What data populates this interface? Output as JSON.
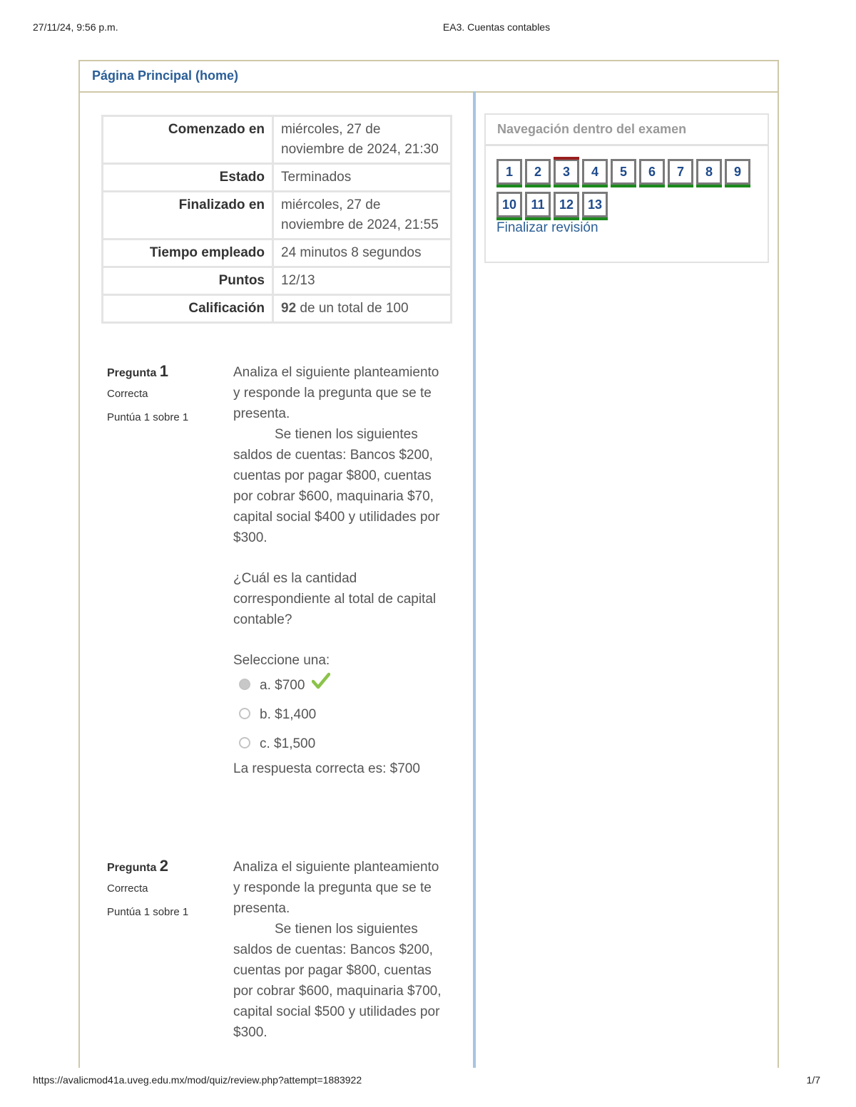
{
  "print": {
    "date": "27/11/24, 9:56 p.m.",
    "title": "EA3. Cuentas contables",
    "url": "https://avalicmod41a.uveg.edu.mx/mod/quiz/review.php?attempt=1883922",
    "page": "1/7"
  },
  "nav": {
    "home": "Página Principal (home)"
  },
  "summary": {
    "started_label": "Comenzado en",
    "started_value": "miércoles, 27 de noviembre de 2024, 21:30",
    "state_label": "Estado",
    "state_value": "Terminados",
    "finished_label": "Finalizado en",
    "finished_value": "miércoles, 27 de noviembre de 2024, 21:55",
    "time_label": "Tiempo empleado",
    "time_value": "24 minutos 8 segundos",
    "points_label": "Puntos",
    "points_value": "12/13",
    "grade_label": "Calificación",
    "grade_value": "92",
    "grade_suffix": " de un total de 100"
  },
  "questions": [
    {
      "label": "Pregunta",
      "number": "1",
      "state": "Correcta",
      "grade": "Puntúa 1 sobre 1",
      "intro": "Analiza el siguiente planteamiento y responde la pregunta que se te presenta.",
      "body": "Se tienen los siguientes saldos de cuentas: Bancos $200, cuentas por pagar $800, cuentas por cobrar $600, maquinaria $70, capital social $400 y utilidades por $300.",
      "question": "¿Cuál es la cantidad correspondiente al total de capital contable?",
      "prompt": "Seleccione una:",
      "options": [
        "a. $700",
        "b. $1,400",
        "c. $1,500"
      ],
      "answer": "La respuesta correcta es: $700"
    },
    {
      "label": "Pregunta",
      "number": "2",
      "state": "Correcta",
      "grade": "Puntúa 1 sobre 1",
      "intro": "Analiza el siguiente planteamiento y responde la pregunta que se te presenta.",
      "body": "Se tienen los siguientes saldos de cuentas: Bancos $200, cuentas por pagar $800, cuentas por cobrar $600, maquinaria $700, capital social $500 y utilidades por $300."
    }
  ],
  "quiz_nav": {
    "title": "Navegación dentro del examen",
    "buttons": [
      "1",
      "2",
      "3",
      "4",
      "5",
      "6",
      "7",
      "8",
      "9",
      "10",
      "11",
      "12",
      "13"
    ],
    "current": "3",
    "finish": "Finalizar revisión"
  },
  "colors": {
    "link": "#2a5e97",
    "correct": "#1c8a1c",
    "current_marker": "#9a1f1f",
    "check": "#8bc34a"
  }
}
